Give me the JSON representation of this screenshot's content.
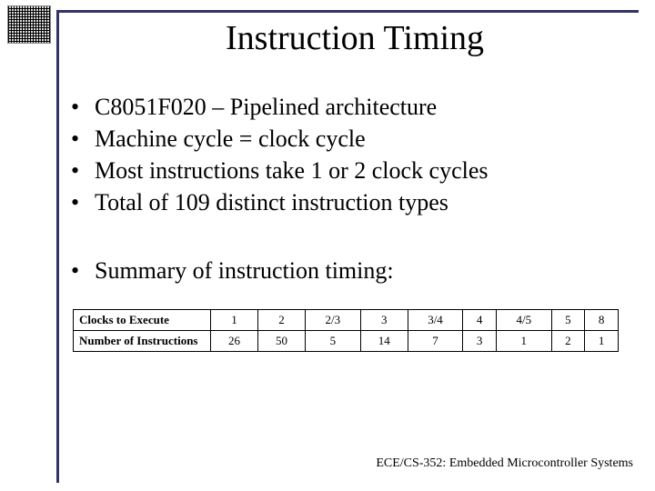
{
  "title": "Instruction Timing",
  "bullets_a": [
    "C8051F020 – Pipelined architecture",
    "Machine cycle = clock cycle",
    "Most instructions take 1 or 2 clock cycles",
    "Total of 109 distinct instruction types"
  ],
  "bullets_b": [
    "Summary of instruction timing:"
  ],
  "table": {
    "row_headers": [
      "Clocks to Execute",
      "Number of Instructions"
    ],
    "columns": [
      "1",
      "2",
      "2/3",
      "3",
      "3/4",
      "4",
      "4/5",
      "5",
      "8"
    ],
    "rows": [
      [
        "26",
        "50",
        "5",
        "14",
        "7",
        "3",
        "1",
        "2",
        "1"
      ]
    ]
  },
  "footer": "ECE/CS-352: Embedded Microcontroller Systems",
  "chart_data": {
    "type": "table",
    "title": "Summary of instruction timing",
    "row_headers": [
      "Clocks to Execute",
      "Number of Instructions"
    ],
    "columns": [
      "1",
      "2",
      "2/3",
      "3",
      "3/4",
      "4",
      "4/5",
      "5",
      "8"
    ],
    "data": [
      [
        26,
        50,
        5,
        14,
        7,
        3,
        1,
        2,
        1
      ]
    ]
  }
}
